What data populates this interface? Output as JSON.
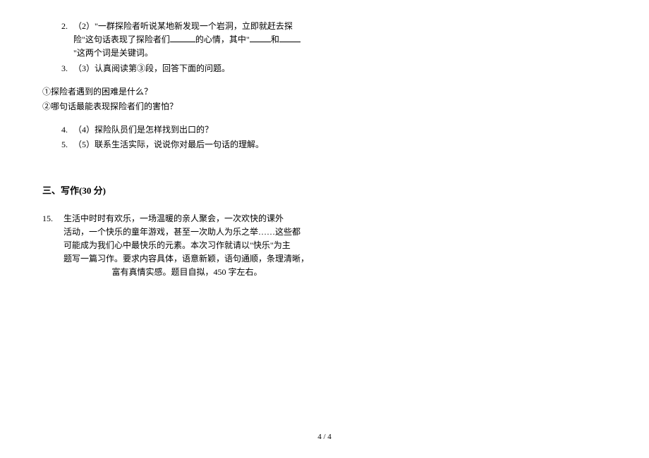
{
  "items": {
    "q2_num": "2.",
    "q2_text_a": "（2）\"一群探险者听说某地新发现一个岩洞，立即就赶去探险\"这句话表现了探险者们",
    "q2_text_b": "的心情，其中\"",
    "q2_text_c": "和",
    "q2_text_d": "\"这两个词是关键词。",
    "q3_num": "3.",
    "q3_text": "（3）认真阅读第③段，回答下面的问题。",
    "subq1": "①探险者遇到的困难是什么？",
    "subq2": "②哪句话最能表现探险者们的害怕？",
    "q4_num": "4.",
    "q4_text": "（4）探险队员们是怎样找到出口的？",
    "q5_num": "5.",
    "q5_text": "（5）联系生活实际，说说你对最后一句话的理解。"
  },
  "section": {
    "heading": "三、写作(30 分)"
  },
  "essay": {
    "num": "15.",
    "line1": "生活中时时有欢乐，一场温暖的亲人聚会，一次欢快的课外",
    "line2": "活动，一个快乐的童年游戏，甚至一次助人为乐之举……这些都",
    "line3": "可能成为我们心中最快乐的元素。本次习作就请以\"快乐\"为主",
    "line4": "题写一篇习作。要求内容具体，语意新颖，语句通顺，条理清晰，",
    "line5": "富有真情实感。题目自拟，450 字左右。"
  },
  "footer": {
    "page": "4 / 4"
  }
}
